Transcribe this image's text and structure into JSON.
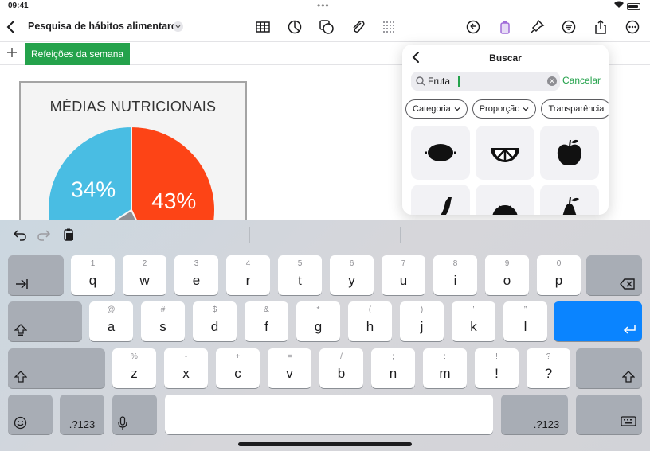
{
  "status": {
    "time": "09:41"
  },
  "toolbar": {
    "title": "Pesquisa de hábitos alimentares",
    "icons": [
      "back-icon",
      "title-menu-icon",
      "table-icon",
      "chart-icon",
      "shapes-icon",
      "attachment-icon",
      "media-grid-icon",
      "undo-history-icon",
      "format-brush-icon",
      "pin-icon",
      "organize-icon",
      "share-icon",
      "more-icon"
    ]
  },
  "tabs": {
    "active": "Refeições da semana"
  },
  "chart_data": {
    "type": "pie",
    "title": "MÉDIAS NUTRICIONAIS",
    "labels": [
      "43%",
      "34%"
    ],
    "values": [
      43,
      34,
      23
    ],
    "colors": [
      "#fd4416",
      "#49bde3",
      "#8e8e93"
    ]
  },
  "search": {
    "title": "Buscar",
    "value": "Fruta",
    "placeholder": "Buscar",
    "cancel": "Cancelar",
    "filters": [
      "Categoria",
      "Proporção",
      "Transparência"
    ],
    "results": [
      "lemon-shape",
      "orange-slice-shape",
      "apple-shape",
      "banana-shape",
      "tomato-shape",
      "pear-shape"
    ]
  },
  "keyboard": {
    "row1": [
      {
        "k": "q",
        "h": "1"
      },
      {
        "k": "w",
        "h": "2"
      },
      {
        "k": "e",
        "h": "3"
      },
      {
        "k": "r",
        "h": "4"
      },
      {
        "k": "t",
        "h": "5"
      },
      {
        "k": "y",
        "h": "6"
      },
      {
        "k": "u",
        "h": "7"
      },
      {
        "k": "i",
        "h": "8"
      },
      {
        "k": "o",
        "h": "9"
      },
      {
        "k": "p",
        "h": "0"
      }
    ],
    "row2": [
      {
        "k": "a",
        "h": "@"
      },
      {
        "k": "s",
        "h": "#"
      },
      {
        "k": "d",
        "h": "$"
      },
      {
        "k": "f",
        "h": "&"
      },
      {
        "k": "g",
        "h": "*"
      },
      {
        "k": "h",
        "h": "("
      },
      {
        "k": "j",
        "h": ")"
      },
      {
        "k": "k",
        "h": "’"
      },
      {
        "k": "l",
        "h": "”"
      }
    ],
    "row3": [
      {
        "k": "z",
        "h": "%"
      },
      {
        "k": "x",
        "h": "-"
      },
      {
        "k": "c",
        "h": "+"
      },
      {
        "k": "v",
        "h": "="
      },
      {
        "k": "b",
        "h": "/"
      },
      {
        "k": "n",
        "h": ";"
      },
      {
        "k": "m",
        "h": ":"
      },
      {
        "k": "!",
        "h": "!"
      },
      {
        "k": "?",
        "h": "?"
      }
    ],
    "numbers_label": ".?123"
  }
}
